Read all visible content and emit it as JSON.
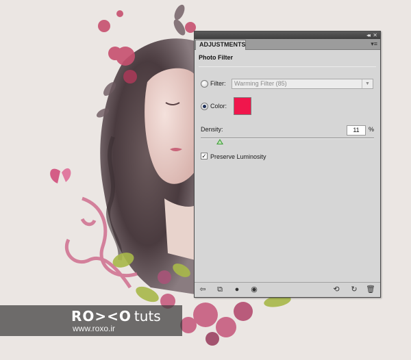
{
  "panel": {
    "tab_label": "ADJUSTMENTS",
    "title": "Photo Filter",
    "filter": {
      "label": "Filter:",
      "selected": "Warming Filter (85)",
      "checked": false
    },
    "color": {
      "label": "Color:",
      "swatch": "#f0164c",
      "checked": true
    },
    "density": {
      "label": "Density:",
      "value": "11",
      "unit": "%",
      "level_percent": 11
    },
    "preserve_luminosity": {
      "label": "Preserve Luminosity",
      "checked": true,
      "check_glyph": "✓"
    },
    "top_icons": {
      "collapse_glyph": "◂◂",
      "close_glyph": "✕",
      "menu_glyph": "▾≡"
    },
    "bottom_icons": [
      {
        "name": "back-arrow-icon",
        "glyph": "⇦"
      },
      {
        "name": "expanded-view-icon",
        "glyph": "⧉"
      },
      {
        "name": "clip-to-layer-icon",
        "glyph": "●"
      },
      {
        "name": "visibility-eye-icon",
        "glyph": "◉"
      },
      {
        "name": "view-previous-state-icon",
        "glyph": "⟲"
      },
      {
        "name": "reset-icon",
        "glyph": "↻"
      },
      {
        "name": "trash-icon",
        "glyph": "🗑"
      }
    ]
  },
  "watermark": {
    "logo": "RO><O",
    "tuts": "tuts",
    "url": "www.roxo.ir"
  },
  "colors": {
    "panel_bg": "#d6d6d6",
    "accent_swatch": "#f0164c",
    "slider_thumb": "#3f9d3a"
  }
}
